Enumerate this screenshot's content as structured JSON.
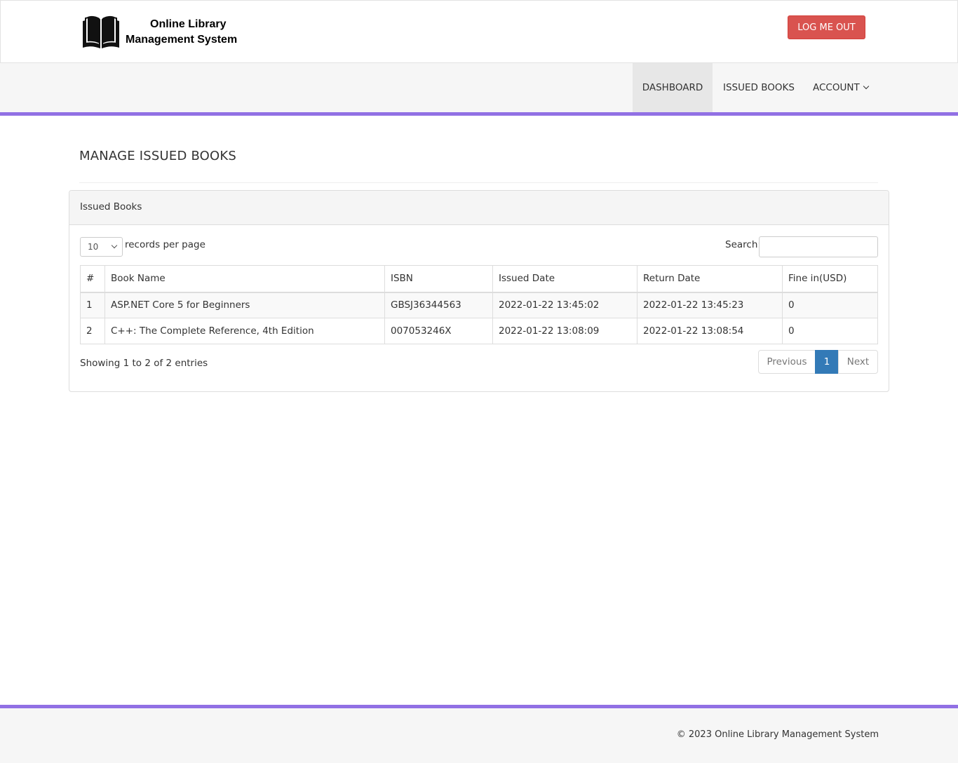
{
  "header": {
    "logo_line1": "Online Library",
    "logo_line2": "Management System",
    "logout_label": "LOG ME OUT"
  },
  "nav": {
    "dashboard": "DASHBOARD",
    "issued_books": "ISSUED BOOKS",
    "account": "ACCOUNT"
  },
  "page_title": "MANAGE ISSUED BOOKS",
  "panel": {
    "heading": "Issued Books",
    "length_value": "10",
    "length_label": "records per page",
    "search_label": "Search:",
    "columns": [
      "#",
      "Book Name",
      "ISBN",
      "Issued Date",
      "Return Date",
      "Fine in(USD)"
    ],
    "rows": [
      [
        "1",
        "ASP.NET Core 5 for Beginners",
        "GBSJ36344563",
        "2022-01-22 13:45:02",
        "2022-01-22 13:45:23",
        "0"
      ],
      [
        "2",
        "C++: The Complete Reference, 4th Edition",
        "007053246X",
        "2022-01-22 13:08:09",
        "2022-01-22 13:08:54",
        "0"
      ]
    ],
    "info": "Showing 1 to 2 of 2 entries",
    "pager": {
      "previous": "Previous",
      "current": "1",
      "next": "Next"
    }
  },
  "footer": {
    "text": "© 2023 Online Library Management System"
  },
  "colors": {
    "accent": "#9170e4",
    "danger": "#d9534f",
    "primary": "#337ab7"
  }
}
